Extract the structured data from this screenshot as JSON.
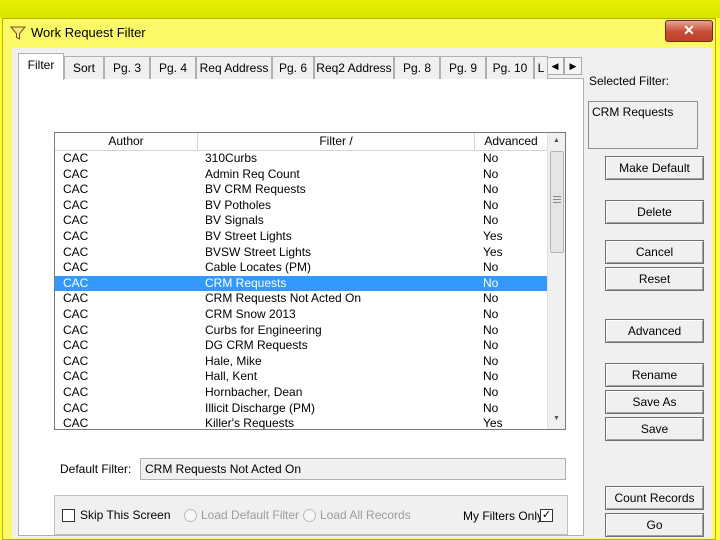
{
  "window": {
    "title": "Work Request Filter",
    "close_glyph": "✕"
  },
  "tabs": [
    {
      "label": "Filter",
      "active": true
    },
    {
      "label": "Sort"
    },
    {
      "label": "Pg. 3"
    },
    {
      "label": "Pg. 4"
    },
    {
      "label": "Req Address"
    },
    {
      "label": "Pg. 6"
    },
    {
      "label": "Req2 Address"
    },
    {
      "label": "Pg. 8"
    },
    {
      "label": "Pg. 9"
    },
    {
      "label": "Pg. 10"
    },
    {
      "label": "L"
    }
  ],
  "tab_scroll": {
    "left": "◀",
    "right": "▶"
  },
  "list": {
    "columns": [
      "Author",
      "Filter /",
      "Advanced"
    ],
    "selected_index": 8,
    "rows": [
      [
        "CAC",
        "310Curbs",
        "No"
      ],
      [
        "CAC",
        "Admin Req Count",
        "No"
      ],
      [
        "CAC",
        "BV CRM Requests",
        "No"
      ],
      [
        "CAC",
        "BV Potholes",
        "No"
      ],
      [
        "CAC",
        "BV Signals",
        "No"
      ],
      [
        "CAC",
        "BV Street Lights",
        "Yes"
      ],
      [
        "CAC",
        "BVSW Street Lights",
        "Yes"
      ],
      [
        "CAC",
        "Cable Locates (PM)",
        "No"
      ],
      [
        "CAC",
        "CRM Requests",
        "No"
      ],
      [
        "CAC",
        "CRM Requests Not Acted On",
        "No"
      ],
      [
        "CAC",
        "CRM Snow 2013",
        "No"
      ],
      [
        "CAC",
        "Curbs for Engineering",
        "No"
      ],
      [
        "CAC",
        "DG CRM Requests",
        "No"
      ],
      [
        "CAC",
        "Hale, Mike",
        "No"
      ],
      [
        "CAC",
        "Hall, Kent",
        "No"
      ],
      [
        "CAC",
        "Hornbacher, Dean",
        "No"
      ],
      [
        "CAC",
        "Illicit Discharge (PM)",
        "No"
      ],
      [
        "CAC",
        "Killer's Requests",
        "Yes"
      ]
    ]
  },
  "selected_filter": {
    "label": "Selected Filter:",
    "value": "CRM Requests"
  },
  "buttons": {
    "make_default": "Make Default",
    "delete": "Delete",
    "cancel": "Cancel",
    "reset": "Reset",
    "advanced": "Advanced",
    "rename": "Rename",
    "save_as": "Save As",
    "save": "Save",
    "count_records": "Count Records",
    "go": "Go"
  },
  "default_filter": {
    "label": "Default Filter:",
    "value": "CRM Requests Not Acted On"
  },
  "options": {
    "skip_this_screen": "Skip This Screen",
    "skip_checked": false,
    "load_default_filter": "Load Default Filter",
    "load_all_records": "Load All Records",
    "my_filters_only": "My Filters Only",
    "my_filters_checked": true,
    "check_glyph": "✓"
  },
  "colors": {
    "selection": "#3399ff",
    "titlebar": "#fbfa66",
    "close": "#c44c36"
  }
}
